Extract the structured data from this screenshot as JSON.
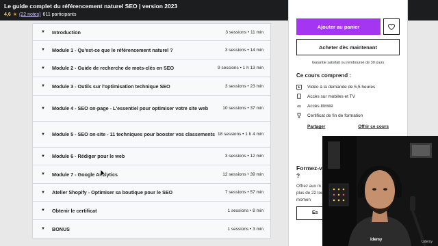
{
  "header": {
    "title": "Le guide complet du référencement naturel SEO | version 2023",
    "rating": "4,6",
    "reviews_link": "(22 notes)",
    "participants": "611 participants"
  },
  "curriculum": {
    "sections": [
      {
        "title": "Introduction",
        "meta": "3 sessions • 11 min"
      },
      {
        "title": "Module 1 - Qu'est-ce que le référencement naturel ?",
        "meta": "3 sessions • 14 min"
      },
      {
        "title": "Module 2 - Guide de recherche de mots-clés en SEO",
        "meta": "9 sessions • 1 h 13 min"
      },
      {
        "title": "Module 3 - Outils sur l'optimisation technique SEO",
        "meta": "3 sessions • 23 min"
      },
      {
        "title": "Module 4 - SEO on-page - L'essentiel pour optimiser votre site web",
        "meta": "10 sessions • 37 min"
      },
      {
        "title": "Module 5 - SEO on-site - 11 techniques pour booster vos classements",
        "meta": "18 sessions • 1 h 4 min"
      },
      {
        "title": "Module 6 - Rédiger pour le web",
        "meta": "3 sessions • 12 min"
      },
      {
        "title": "Module 7 - Google Analytics",
        "meta": "12 sessions • 39 min"
      },
      {
        "title": "Atelier Shopify - Optimiser sa boutique pour le SEO",
        "meta": "7 sessions • 57 min"
      },
      {
        "title": "Obtenir le certificat",
        "meta": "1 sessions • 8 min"
      },
      {
        "title": "BONUS",
        "meta": "1 sessions • 3 min"
      }
    ]
  },
  "sidebar": {
    "add_to_cart": "Ajouter au panier",
    "buy_now": "Acheter dès maintenant",
    "guarantee": "Garantie satisfait ou remboursé de 30 jours",
    "includes_title": "Ce cours comprend :",
    "includes": [
      {
        "icon": "video-icon",
        "label": "Vidéo à la demande de 5,5 heures"
      },
      {
        "icon": "mobile-icon",
        "label": "Accès sur mobiles et TV"
      },
      {
        "icon": "infinity-icon",
        "label": "Accès illimité"
      },
      {
        "icon": "trophy-icon",
        "label": "Certificat de fin de formation"
      }
    ],
    "share_link": "Partager",
    "gift_link": "Offrir ce cours",
    "promo_title": "Formez-v plus ?",
    "promo_text": "Offrez aux m à plus de 22 tout momen",
    "promo_button": "Es"
  },
  "overlay": {
    "cam_watermark": "Udemy",
    "logo_text": "idemy"
  },
  "colors": {
    "header_bg": "#1c1d1f",
    "accent_purple": "#a435f0",
    "star": "#e59819",
    "page_bg": "#e8e8e8"
  }
}
